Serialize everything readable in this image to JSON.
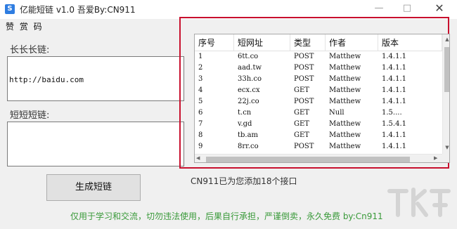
{
  "window": {
    "title": "亿能短链 v1.0 吾爱By:CN911",
    "icon": "app-logo-icon",
    "controls": {
      "minimize": "minimize-icon",
      "maximize": "maximize-icon",
      "close": "close-icon"
    }
  },
  "menu": {
    "appreciate": "赞 赏 码"
  },
  "long_link": {
    "label": "长长长链:",
    "value": "http://baidu.com"
  },
  "short_link": {
    "label": "短短短链:",
    "value": ""
  },
  "generate_button": "生成短链",
  "table": {
    "headers": [
      "序号",
      "短网址",
      "类型",
      "作者",
      "版本"
    ],
    "rows": [
      [
        "1",
        "6tt.co",
        "POST",
        "Matthew",
        "1.4.1.1"
      ],
      [
        "2",
        "aad.tw",
        "POST",
        "Matthew",
        "1.4.1.1"
      ],
      [
        "3",
        "33h.co",
        "POST",
        "Matthew",
        "1.4.1.1"
      ],
      [
        "4",
        "ecx.cx",
        "GET",
        "Matthew",
        "1.4.1.1"
      ],
      [
        "5",
        "22j.co",
        "POST",
        "Matthew",
        "1.4.1.1"
      ],
      [
        "6",
        "t.cn",
        "GET",
        "Null",
        "1.5...."
      ],
      [
        "7",
        "v.gd",
        "GET",
        "Matthew",
        "1.5.4.1"
      ],
      [
        "8",
        "tb.am",
        "GET",
        "Matthew",
        "1.4.1.1"
      ],
      [
        "9",
        "8rr.co",
        "POST",
        "Matthew",
        "1.4.1.1"
      ]
    ]
  },
  "status": "CN911已为您添加18个接口",
  "footer": "仅用于学习和交流，切勿违法使用，后果自行承担，严谨倒卖，永久免费 by:Cn911",
  "colors": {
    "highlight_frame": "#c8102e",
    "footer_text": "#3a9a3a"
  }
}
